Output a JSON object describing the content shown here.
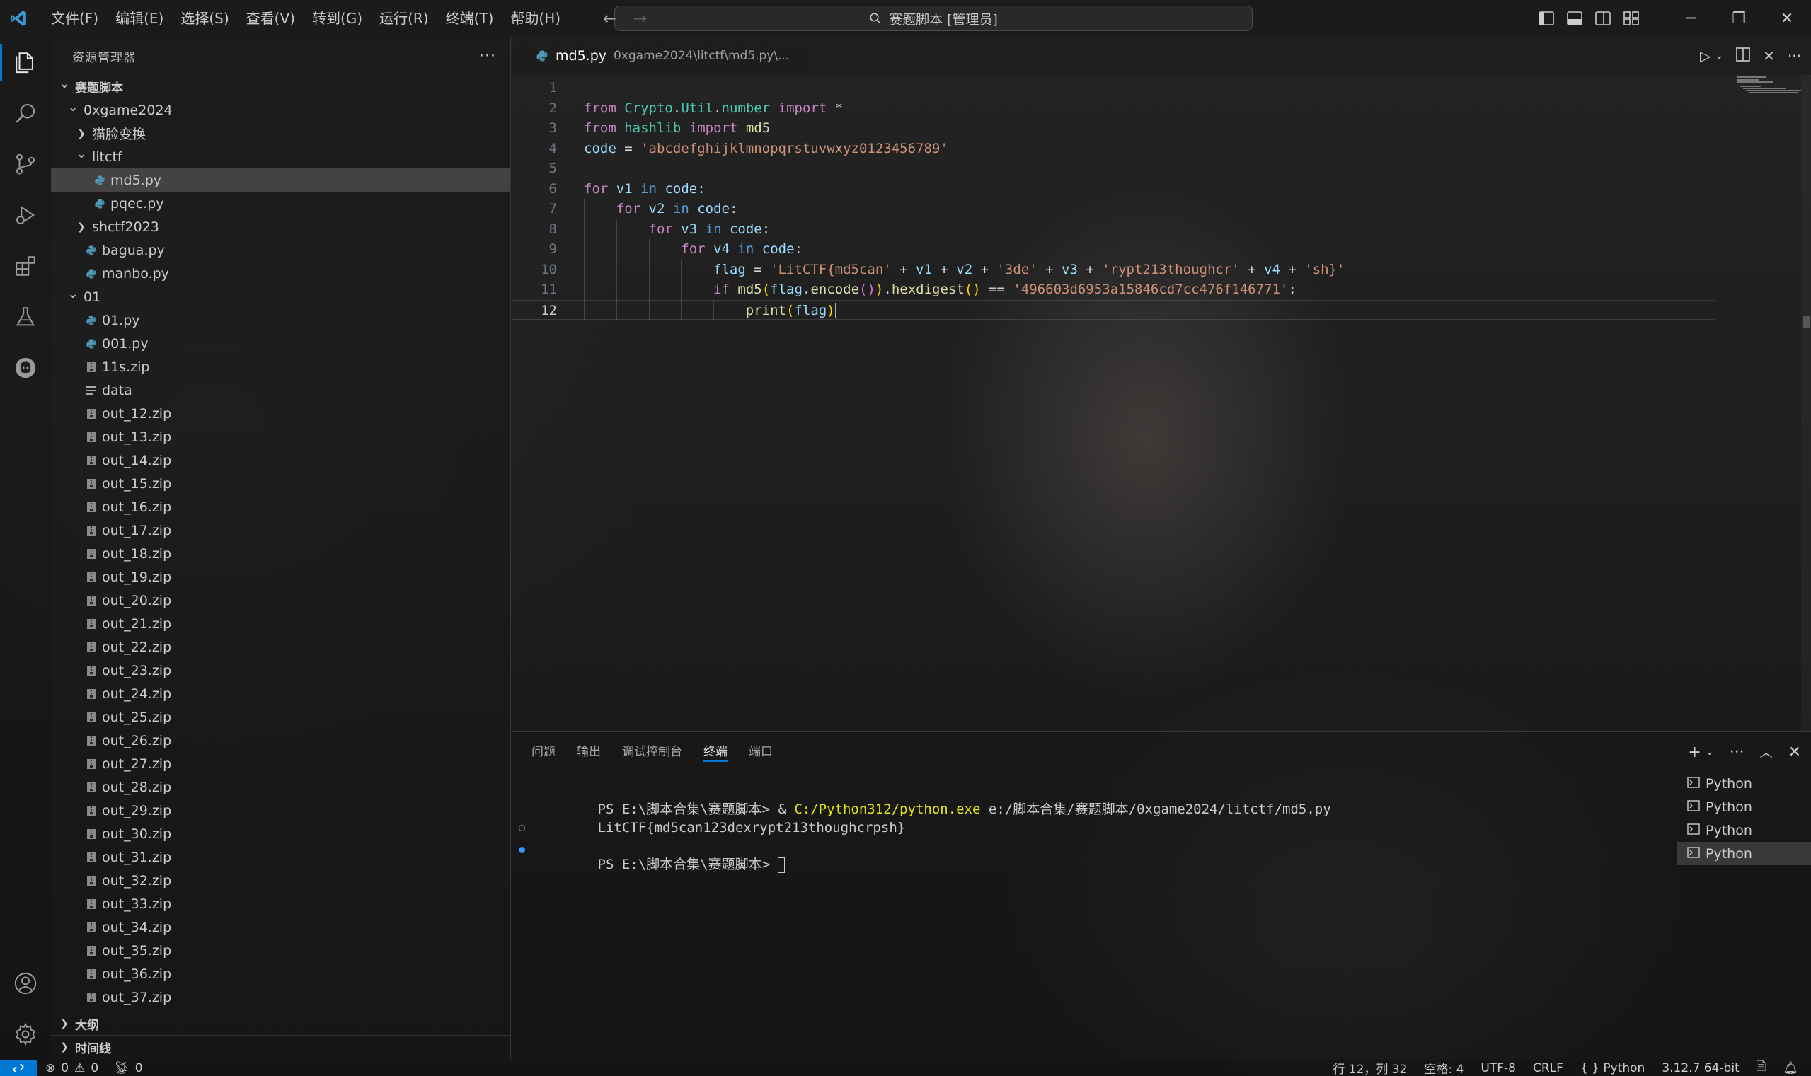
{
  "titlebar": {
    "menu": [
      "文件(F)",
      "编辑(E)",
      "选择(S)",
      "查看(V)",
      "转到(G)",
      "运行(R)",
      "终端(T)",
      "帮助(H)"
    ],
    "search_text": "赛题脚本 [管理员]"
  },
  "sidebar": {
    "title": "资源管理器",
    "tree": [
      {
        "label": "赛题脚本",
        "depth": 0,
        "kind": "folder-open",
        "bold": true
      },
      {
        "label": "0xgame2024",
        "depth": 1,
        "kind": "folder-open"
      },
      {
        "label": "猫脸变换",
        "depth": 2,
        "kind": "folder-closed"
      },
      {
        "label": "litctf",
        "depth": 2,
        "kind": "folder-open"
      },
      {
        "label": "md5.py",
        "depth": 3,
        "kind": "python",
        "selected": true
      },
      {
        "label": "pqec.py",
        "depth": 3,
        "kind": "python"
      },
      {
        "label": "shctf2023",
        "depth": 2,
        "kind": "folder-closed"
      },
      {
        "label": "bagua.py",
        "depth": 2,
        "kind": "python"
      },
      {
        "label": "manbo.py",
        "depth": 2,
        "kind": "python"
      },
      {
        "label": "01",
        "depth": 1,
        "kind": "folder-open"
      },
      {
        "label": "01.py",
        "depth": 2,
        "kind": "python"
      },
      {
        "label": "001.py",
        "depth": 2,
        "kind": "python"
      },
      {
        "label": "11s.zip",
        "depth": 2,
        "kind": "zip"
      },
      {
        "label": "data",
        "depth": 2,
        "kind": "text"
      },
      {
        "label": "out_12.zip",
        "depth": 2,
        "kind": "zip"
      },
      {
        "label": "out_13.zip",
        "depth": 2,
        "kind": "zip"
      },
      {
        "label": "out_14.zip",
        "depth": 2,
        "kind": "zip"
      },
      {
        "label": "out_15.zip",
        "depth": 2,
        "kind": "zip"
      },
      {
        "label": "out_16.zip",
        "depth": 2,
        "kind": "zip"
      },
      {
        "label": "out_17.zip",
        "depth": 2,
        "kind": "zip"
      },
      {
        "label": "out_18.zip",
        "depth": 2,
        "kind": "zip"
      },
      {
        "label": "out_19.zip",
        "depth": 2,
        "kind": "zip"
      },
      {
        "label": "out_20.zip",
        "depth": 2,
        "kind": "zip"
      },
      {
        "label": "out_21.zip",
        "depth": 2,
        "kind": "zip"
      },
      {
        "label": "out_22.zip",
        "depth": 2,
        "kind": "zip"
      },
      {
        "label": "out_23.zip",
        "depth": 2,
        "kind": "zip"
      },
      {
        "label": "out_24.zip",
        "depth": 2,
        "kind": "zip"
      },
      {
        "label": "out_25.zip",
        "depth": 2,
        "kind": "zip"
      },
      {
        "label": "out_26.zip",
        "depth": 2,
        "kind": "zip"
      },
      {
        "label": "out_27.zip",
        "depth": 2,
        "kind": "zip"
      },
      {
        "label": "out_28.zip",
        "depth": 2,
        "kind": "zip"
      },
      {
        "label": "out_29.zip",
        "depth": 2,
        "kind": "zip"
      },
      {
        "label": "out_30.zip",
        "depth": 2,
        "kind": "zip"
      },
      {
        "label": "out_31.zip",
        "depth": 2,
        "kind": "zip"
      },
      {
        "label": "out_32.zip",
        "depth": 2,
        "kind": "zip"
      },
      {
        "label": "out_33.zip",
        "depth": 2,
        "kind": "zip"
      },
      {
        "label": "out_34.zip",
        "depth": 2,
        "kind": "zip"
      },
      {
        "label": "out_35.zip",
        "depth": 2,
        "kind": "zip"
      },
      {
        "label": "out_36.zip",
        "depth": 2,
        "kind": "zip"
      },
      {
        "label": "out_37.zip",
        "depth": 2,
        "kind": "zip"
      }
    ],
    "outline_label": "大纲",
    "timeline_label": "时间线"
  },
  "editor": {
    "tab_name": "md5.py",
    "tab_path": "0xgame2024\\litctf\\md5.py\\...",
    "current_line": 12,
    "lines": [
      [],
      [
        [
          "kw2",
          "from"
        ],
        [
          "op",
          " "
        ],
        [
          "cls",
          "Crypto"
        ],
        [
          "op",
          "."
        ],
        [
          "cls",
          "Util"
        ],
        [
          "op",
          "."
        ],
        [
          "cls",
          "number"
        ],
        [
          "op",
          " "
        ],
        [
          "kw2",
          "import"
        ],
        [
          "op",
          " *"
        ]
      ],
      [
        [
          "kw2",
          "from"
        ],
        [
          "op",
          " "
        ],
        [
          "cls",
          "hashlib"
        ],
        [
          "op",
          " "
        ],
        [
          "kw2",
          "import"
        ],
        [
          "op",
          " "
        ],
        [
          "fn",
          "md5"
        ]
      ],
      [
        [
          "var",
          "code"
        ],
        [
          "op",
          " = "
        ],
        [
          "str",
          "'abcdefghijklmnopqrstuvwxyz0123456789'"
        ]
      ],
      [],
      [
        [
          "kw2",
          "for"
        ],
        [
          "op",
          " "
        ],
        [
          "var",
          "v1"
        ],
        [
          "op",
          " "
        ],
        [
          "kw",
          "in"
        ],
        [
          "op",
          " "
        ],
        [
          "var",
          "code"
        ],
        [
          "op",
          ":"
        ]
      ],
      [
        [
          "op",
          "    "
        ],
        [
          "kw2",
          "for"
        ],
        [
          "op",
          " "
        ],
        [
          "var",
          "v2"
        ],
        [
          "op",
          " "
        ],
        [
          "kw",
          "in"
        ],
        [
          "op",
          " "
        ],
        [
          "var",
          "code"
        ],
        [
          "op",
          ":"
        ]
      ],
      [
        [
          "op",
          "        "
        ],
        [
          "kw2",
          "for"
        ],
        [
          "op",
          " "
        ],
        [
          "var",
          "v3"
        ],
        [
          "op",
          " "
        ],
        [
          "kw",
          "in"
        ],
        [
          "op",
          " "
        ],
        [
          "var",
          "code"
        ],
        [
          "op",
          ":"
        ]
      ],
      [
        [
          "op",
          "            "
        ],
        [
          "kw2",
          "for"
        ],
        [
          "op",
          " "
        ],
        [
          "var",
          "v4"
        ],
        [
          "op",
          " "
        ],
        [
          "kw",
          "in"
        ],
        [
          "op",
          " "
        ],
        [
          "var",
          "code"
        ],
        [
          "op",
          ":"
        ]
      ],
      [
        [
          "op",
          "                "
        ],
        [
          "var",
          "flag"
        ],
        [
          "op",
          " = "
        ],
        [
          "str",
          "'LitCTF{md5can'"
        ],
        [
          "op",
          " + "
        ],
        [
          "var",
          "v1"
        ],
        [
          "op",
          " + "
        ],
        [
          "var",
          "v2"
        ],
        [
          "op",
          " + "
        ],
        [
          "str",
          "'3de'"
        ],
        [
          "op",
          " + "
        ],
        [
          "var",
          "v3"
        ],
        [
          "op",
          " + "
        ],
        [
          "str",
          "'rypt213thoughcr'"
        ],
        [
          "op",
          " + "
        ],
        [
          "var",
          "v4"
        ],
        [
          "op",
          " + "
        ],
        [
          "str",
          "'sh}'"
        ]
      ],
      [
        [
          "op",
          "                "
        ],
        [
          "kw2",
          "if"
        ],
        [
          "op",
          " "
        ],
        [
          "fn",
          "md5"
        ],
        [
          "br1",
          "("
        ],
        [
          "var",
          "flag"
        ],
        [
          "op",
          "."
        ],
        [
          "fn",
          "encode"
        ],
        [
          "br2",
          "()"
        ],
        [
          "br1",
          ")"
        ],
        [
          "op",
          "."
        ],
        [
          "fn",
          "hexdigest"
        ],
        [
          "br1",
          "()"
        ],
        [
          "op",
          " == "
        ],
        [
          "str",
          "'496603d6953a15846cd7cc476f146771'"
        ],
        [
          "op",
          ":"
        ]
      ],
      [
        [
          "op",
          "                    "
        ],
        [
          "fn",
          "print"
        ],
        [
          "br1",
          "("
        ],
        [
          "var",
          "flag"
        ],
        [
          "br1",
          ")"
        ]
      ]
    ]
  },
  "panel": {
    "tabs": [
      "问题",
      "输出",
      "调试控制台",
      "终端",
      "端口"
    ],
    "active_tab": "终端",
    "terminal": {
      "line1_prompt": "PS E:\\脚本合集\\赛题脚本> & ",
      "line1_exe": "C:/Python312/python.exe",
      "line1_arg": " e:/脚本合集/赛题脚本/0xgame2024/litctf/md5.py",
      "line2": "LitCTF{md5can123dexrypt213thoughcrpsh}",
      "line3_prompt": "PS E:\\脚本合集\\赛题脚本> "
    },
    "terminal_list": [
      "Python",
      "Python",
      "Python",
      "Python"
    ]
  },
  "statusbar": {
    "errors": "0",
    "warnings": "0",
    "ports": "0",
    "position": "行 12，列 32",
    "spaces": "空格: 4",
    "encoding": "UTF-8",
    "eol": "CRLF",
    "language": "Python",
    "interpreter": "3.12.7 64-bit"
  },
  "colors": {
    "accent": "#0078d4",
    "python_icon": "#519aba"
  }
}
